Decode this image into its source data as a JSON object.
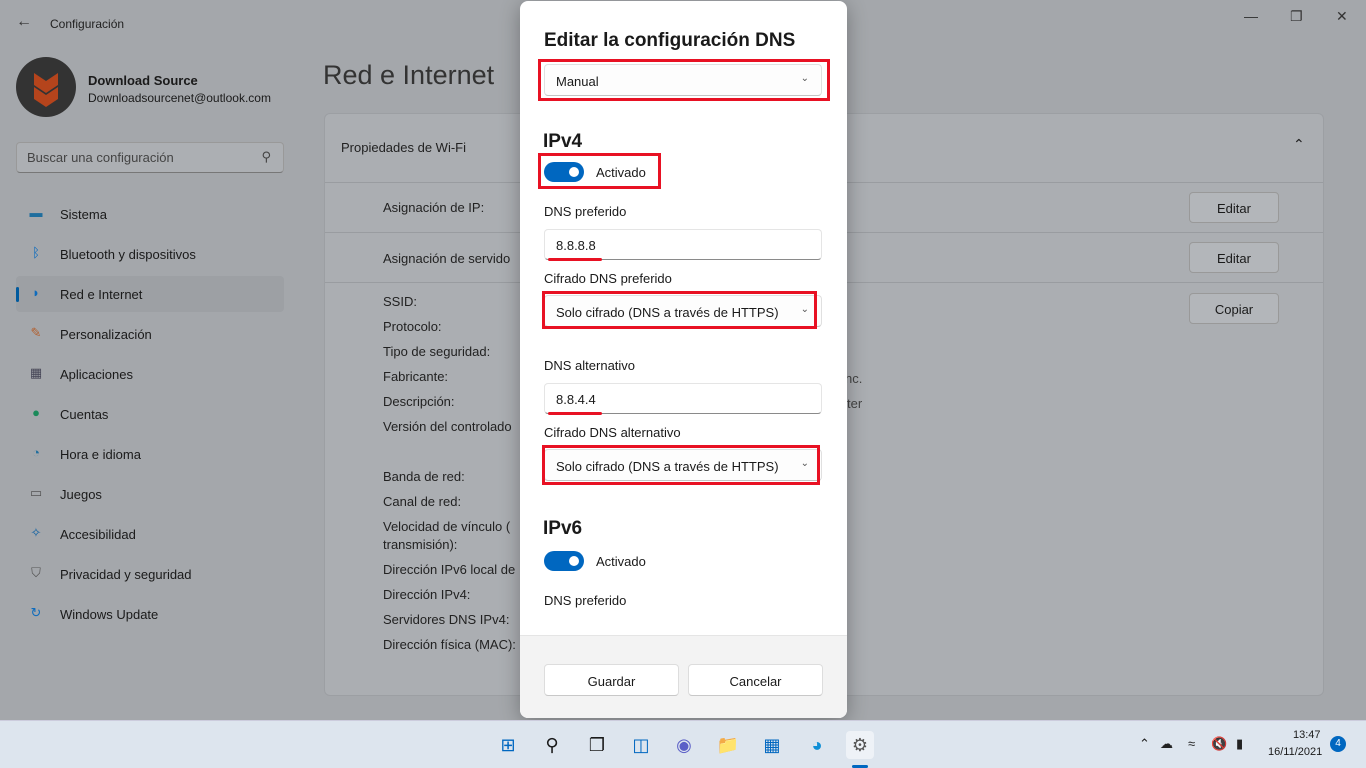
{
  "window": {
    "title": "Configuración",
    "back_icon": "arrow-left-icon",
    "controls": [
      "minimize",
      "maximize",
      "close"
    ]
  },
  "user": {
    "name": "Download Source",
    "email": "Downloadsourcenet@outlook.com"
  },
  "search": {
    "placeholder": "Buscar una configuración"
  },
  "sidebar": {
    "items": [
      {
        "label": "Sistema",
        "icon": "monitor-icon"
      },
      {
        "label": "Bluetooth y dispositivos",
        "icon": "bluetooth-icon"
      },
      {
        "label": "Red e Internet",
        "icon": "wifi-icon",
        "selected": true
      },
      {
        "label": "Personalización",
        "icon": "brush-icon"
      },
      {
        "label": "Aplicaciones",
        "icon": "apps-icon"
      },
      {
        "label": "Cuentas",
        "icon": "person-icon"
      },
      {
        "label": "Hora e idioma",
        "icon": "clock-globe-icon"
      },
      {
        "label": "Juegos",
        "icon": "gamepad-icon"
      },
      {
        "label": "Accesibilidad",
        "icon": "accessibility-icon"
      },
      {
        "label": "Privacidad y seguridad",
        "icon": "shield-icon"
      },
      {
        "label": "Windows Update",
        "icon": "update-icon"
      }
    ]
  },
  "page": {
    "title": "Red e Internet",
    "card_title": "Propiedades de Wi-Fi",
    "ip_assignment": "Asignación de IP:",
    "dns_assignment": "Asignación de servido",
    "edit_label": "Editar",
    "copy_label": "Copiar",
    "props": [
      "SSID:",
      "Protocolo:",
      "Tipo de seguridad:",
      "Fabricante:",
      "Descripción:",
      "Versión del controlado",
      "Banda de red:",
      "Canal de red:",
      "Velocidad de vínculo (",
      "transmisión):",
      "Dirección IPv6 local de",
      "Dirección IPv4:",
      "Servidores DNS IPv4:",
      "Dirección física (MAC):"
    ],
    "fragments": [
      "nc.",
      "ter"
    ]
  },
  "dialog": {
    "title": "Editar la configuración DNS",
    "mode": "Manual",
    "ipv4": {
      "heading": "IPv4",
      "toggle_label": "Activado",
      "toggle_on": true,
      "preferred_label": "DNS preferido",
      "preferred_value": "8.8.8.8",
      "preferred_enc_label": "Cifrado DNS preferido",
      "preferred_enc_value": "Solo cifrado (DNS a través de HTTPS)",
      "alternate_label": "DNS alternativo",
      "alternate_value": "8.8.4.4",
      "alternate_enc_label": "Cifrado DNS alternativo",
      "alternate_enc_value": "Solo cifrado (DNS a través de HTTPS)"
    },
    "ipv6": {
      "heading": "IPv6",
      "toggle_label": "Activado",
      "toggle_on": true,
      "preferred_label": "DNS preferido"
    },
    "save": "Guardar",
    "cancel": "Cancelar",
    "highlight_color": "#e81123",
    "accent": "#0067c0"
  },
  "taskbar": {
    "time": "13:47",
    "date": "16/11/2021",
    "notifications": "4"
  }
}
